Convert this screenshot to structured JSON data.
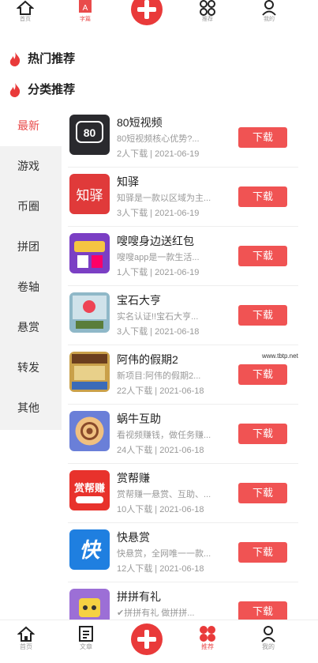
{
  "top_nav": {
    "items": [
      {
        "label": "首页",
        "icon": "home-icon"
      },
      {
        "label": "字篇",
        "icon": "article-icon"
      },
      {
        "label": "发布",
        "icon": "plus-icon"
      },
      {
        "label": "推荐",
        "icon": "apps-icon"
      },
      {
        "label": "我的",
        "icon": "user-icon"
      }
    ]
  },
  "sections": {
    "hot": "热门推荐",
    "category": "分类推荐"
  },
  "categories": [
    "最新",
    "游戏",
    "币圈",
    "拼团",
    "卷轴",
    "悬赏",
    "转发",
    "其他"
  ],
  "apps": [
    {
      "name": "80短视频",
      "desc": "80短视频核心优势?...",
      "meta": "2人下载 | 2021-06-19",
      "action": "下载",
      "thumb_color": "#2a2a2e",
      "thumb_text": "80"
    },
    {
      "name": "知驿",
      "desc": "知驿是一款以区域为主...",
      "meta": "3人下载 | 2021-06-19",
      "action": "下载",
      "thumb_color": "#e03a3a",
      "thumb_text": "知驿"
    },
    {
      "name": "嗖嗖身边送红包",
      "desc": "嗖嗖app是一款生活...",
      "meta": "1人下载 | 2021-06-19",
      "action": "下载",
      "thumb_color": "#7b3fc4",
      "thumb_text": ""
    },
    {
      "name": "宝石大亨",
      "desc": "实名认证!!宝石大亨...",
      "meta": "3人下载 | 2021-06-18",
      "action": "下载",
      "thumb_color": "#8fb8c8",
      "thumb_text": ""
    },
    {
      "name": "阿伟的假期2",
      "desc": "新项目:阿伟的假期2...",
      "meta": "22人下载 | 2021-06-18",
      "action": "下载",
      "thumb_color": "#c9a04a",
      "thumb_text": ""
    },
    {
      "name": "蜗牛互助",
      "desc": "看视频赚钱，做任务赚...",
      "meta": "24人下载 | 2021-06-18",
      "action": "下载",
      "thumb_color": "#6a7fd8",
      "thumb_text": ""
    },
    {
      "name": "赏帮赚",
      "desc": "赏帮赚一悬赏、互助、...",
      "meta": "10人下载 | 2021-06-18",
      "action": "下载",
      "thumb_color": "#e8322c",
      "thumb_text": "赏帮赚"
    },
    {
      "name": "快悬赏",
      "desc": "快悬赏，全网唯一一款...",
      "meta": "12人下载 | 2021-06-18",
      "action": "下载",
      "thumb_color": "#1f7fe0",
      "thumb_text": "快"
    },
    {
      "name": "拼拼有礼",
      "desc": "✔拼拼有礼 做拼拼...",
      "meta": "",
      "action": "下载",
      "thumb_color": "#9c6fd6",
      "thumb_text": ""
    }
  ],
  "watermark": "www.tbtp.net",
  "bottom_nav": {
    "items": [
      {
        "label": "首页",
        "icon": "home-icon"
      },
      {
        "label": "文章",
        "icon": "article-icon"
      },
      {
        "label": "发布",
        "icon": "plus-icon"
      },
      {
        "label": "推荐",
        "icon": "apps-icon"
      },
      {
        "label": "我的",
        "icon": "user-icon"
      }
    ]
  }
}
